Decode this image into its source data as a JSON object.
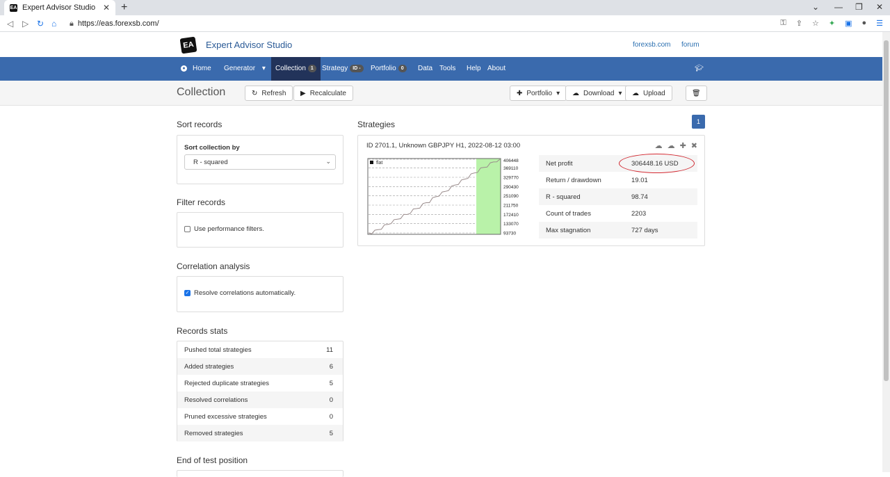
{
  "browser": {
    "tab_title": "Expert Advisor Studio",
    "favicon_text": "EA",
    "url": "https://eas.forexsb.com/"
  },
  "header": {
    "logo_text": "EA",
    "brand": "Expert Advisor Studio",
    "links": [
      "forexsb.com",
      "forum"
    ]
  },
  "nav": {
    "home": "Home",
    "generator": "Generator",
    "collection": "Collection",
    "collection_badge": "1",
    "strategy": "Strategy",
    "strategy_badge": "ID -",
    "portfolio": "Portfolio",
    "portfolio_badge": "0",
    "data": "Data",
    "tools": "Tools",
    "help": "Help",
    "about": "About"
  },
  "page": {
    "title": "Collection",
    "refresh": "Refresh",
    "recalculate": "Recalculate",
    "portfolio": "Portfolio",
    "download": "Download",
    "upload": "Upload"
  },
  "sort": {
    "title": "Sort records",
    "label": "Sort collection by",
    "selected": "R - squared"
  },
  "filter": {
    "title": "Filter records",
    "checkbox_label": "Use performance filters.",
    "checked": false
  },
  "correlation": {
    "title": "Correlation analysis",
    "checkbox_label": "Resolve correlations automatically.",
    "checked": true
  },
  "stats": {
    "title": "Records stats",
    "rows": [
      {
        "label": "Pushed total strategies",
        "value": "11"
      },
      {
        "label": "Added strategies",
        "value": "6"
      },
      {
        "label": "Rejected duplicate strategies",
        "value": "5"
      },
      {
        "label": "Resolved correlations",
        "value": "0"
      },
      {
        "label": "Pruned excessive strategies",
        "value": "0"
      },
      {
        "label": "Removed strategies",
        "value": "5"
      }
    ]
  },
  "end_test": {
    "title": "End of test position"
  },
  "strategies": {
    "title": "Strategies",
    "page": "1",
    "card": {
      "header": "ID 2701.1, Unknown GBPJPY H1, 2022-08-12 03:00",
      "legend": "flat",
      "metrics": [
        {
          "label": "Net profit",
          "value": "306448.16 USD"
        },
        {
          "label": "Return / drawdown",
          "value": "19.01"
        },
        {
          "label": "R - squared",
          "value": "98.74"
        },
        {
          "label": "Count of trades",
          "value": "2203"
        },
        {
          "label": "Max stagnation",
          "value": "727 days"
        }
      ]
    }
  },
  "chart_data": {
    "type": "line",
    "title": "",
    "xlabel": "",
    "ylabel": "",
    "ylim": [
      93730,
      406448
    ],
    "y_ticks": [
      406448,
      369110,
      329770,
      290430,
      251090,
      211750,
      172410,
      133070,
      93730
    ],
    "series": [
      {
        "name": "flat",
        "values": [
          93730,
          96000,
          101000,
          108000,
          115000,
          124000,
          130000,
          139000,
          146000,
          152000,
          160000,
          168000,
          172000,
          182000,
          191000,
          197000,
          205000,
          214000,
          222000,
          228000,
          239000,
          247000,
          256000,
          263000,
          270000,
          280000,
          289000,
          297000,
          305000,
          314000,
          322000,
          331000,
          340000,
          348000,
          356000,
          365000,
          372000,
          379000,
          387000,
          395000,
          401000,
          406448
        ]
      }
    ],
    "grid": true,
    "colors": {
      "line": "#9a8c8c",
      "oos_band": "#b9f2a9"
    }
  }
}
